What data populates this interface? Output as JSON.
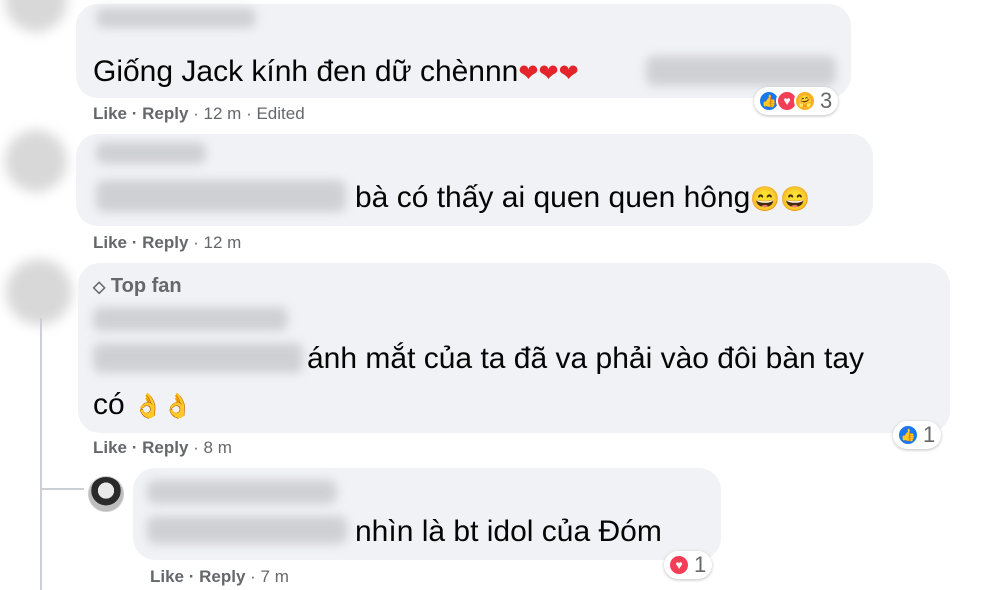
{
  "comments": [
    {
      "text": "Giống Jack kính đen dữ chènnn",
      "emoji": "❤❤❤",
      "actions": {
        "like": "Like",
        "reply": "Reply",
        "time": "12 m",
        "edited": "Edited"
      },
      "reaction_count": "3"
    },
    {
      "text": "bà có thấy ai quen quen hông",
      "emoji": "😄😄",
      "actions": {
        "like": "Like",
        "reply": "Reply",
        "time": "12 m"
      }
    },
    {
      "badge": "Top fan",
      "text_line1": "ánh mắt của ta đã va phải vào đôi bàn tay",
      "text_line2": "có",
      "emoji": "👌👌",
      "actions": {
        "like": "Like",
        "reply": "Reply",
        "time": "8 m"
      },
      "reaction_count": "1"
    },
    {
      "text": "nhìn là bt idol của Đóm",
      "actions": {
        "like": "Like",
        "reply": "Reply",
        "time": "7 m"
      },
      "reaction_count": "1"
    }
  ],
  "separator": " · ",
  "colors": {
    "bubble": "#f0f2f5",
    "action_text": "#65676b",
    "like": "#1877f2",
    "love": "#f33e58"
  },
  "icons": [
    "like-icon",
    "love-icon",
    "care-icon",
    "diamond-icon"
  ]
}
